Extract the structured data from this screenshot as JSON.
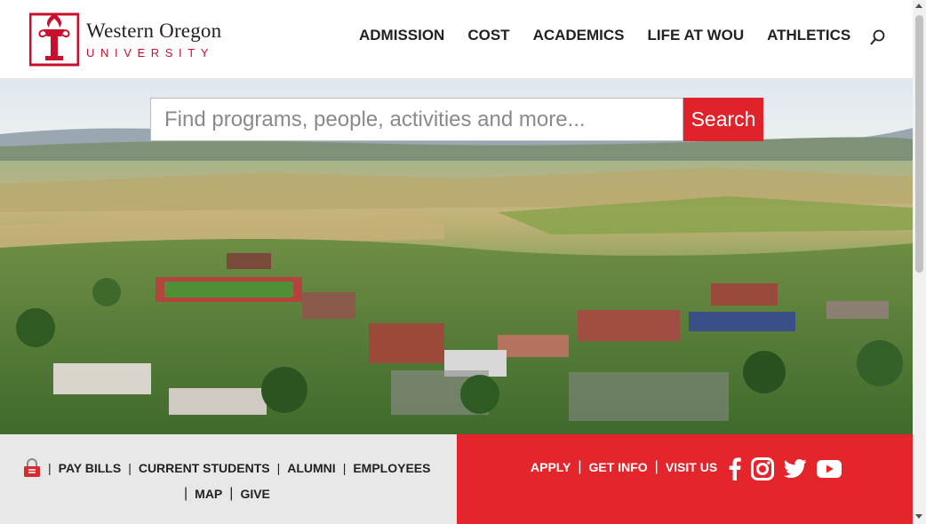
{
  "brand": {
    "name_line1": "Western Oregon",
    "name_line2": "UNIVERSITY",
    "trademark": "™"
  },
  "nav": {
    "items": [
      {
        "label": "ADMISSION"
      },
      {
        "label": "COST"
      },
      {
        "label": "ACADEMICS"
      },
      {
        "label": "LIFE AT WOU"
      },
      {
        "label": "ATHLETICS"
      }
    ],
    "search_icon": "search-icon"
  },
  "hero": {
    "search_placeholder": "Find programs, people, activities and more...",
    "search_button": "Search",
    "image_subject": "aerial view of campus and farmland"
  },
  "quick_links": {
    "lock_icon": "lock-icon",
    "items_row1": [
      "PAY BILLS",
      "CURRENT STUDENTS",
      "ALUMNI",
      "EMPLOYEES"
    ],
    "items_row2": [
      "MAP",
      "GIVE"
    ],
    "separator": "|"
  },
  "cta_links": {
    "items": [
      "APPLY",
      "GET INFO",
      "VISIT US"
    ]
  },
  "social": [
    "facebook-icon",
    "instagram-icon",
    "twitter-icon",
    "youtube-icon"
  ],
  "colors": {
    "brand_red": "#e4252c",
    "logo_red": "#c8102e",
    "footer_gray": "#e8e8e8"
  }
}
